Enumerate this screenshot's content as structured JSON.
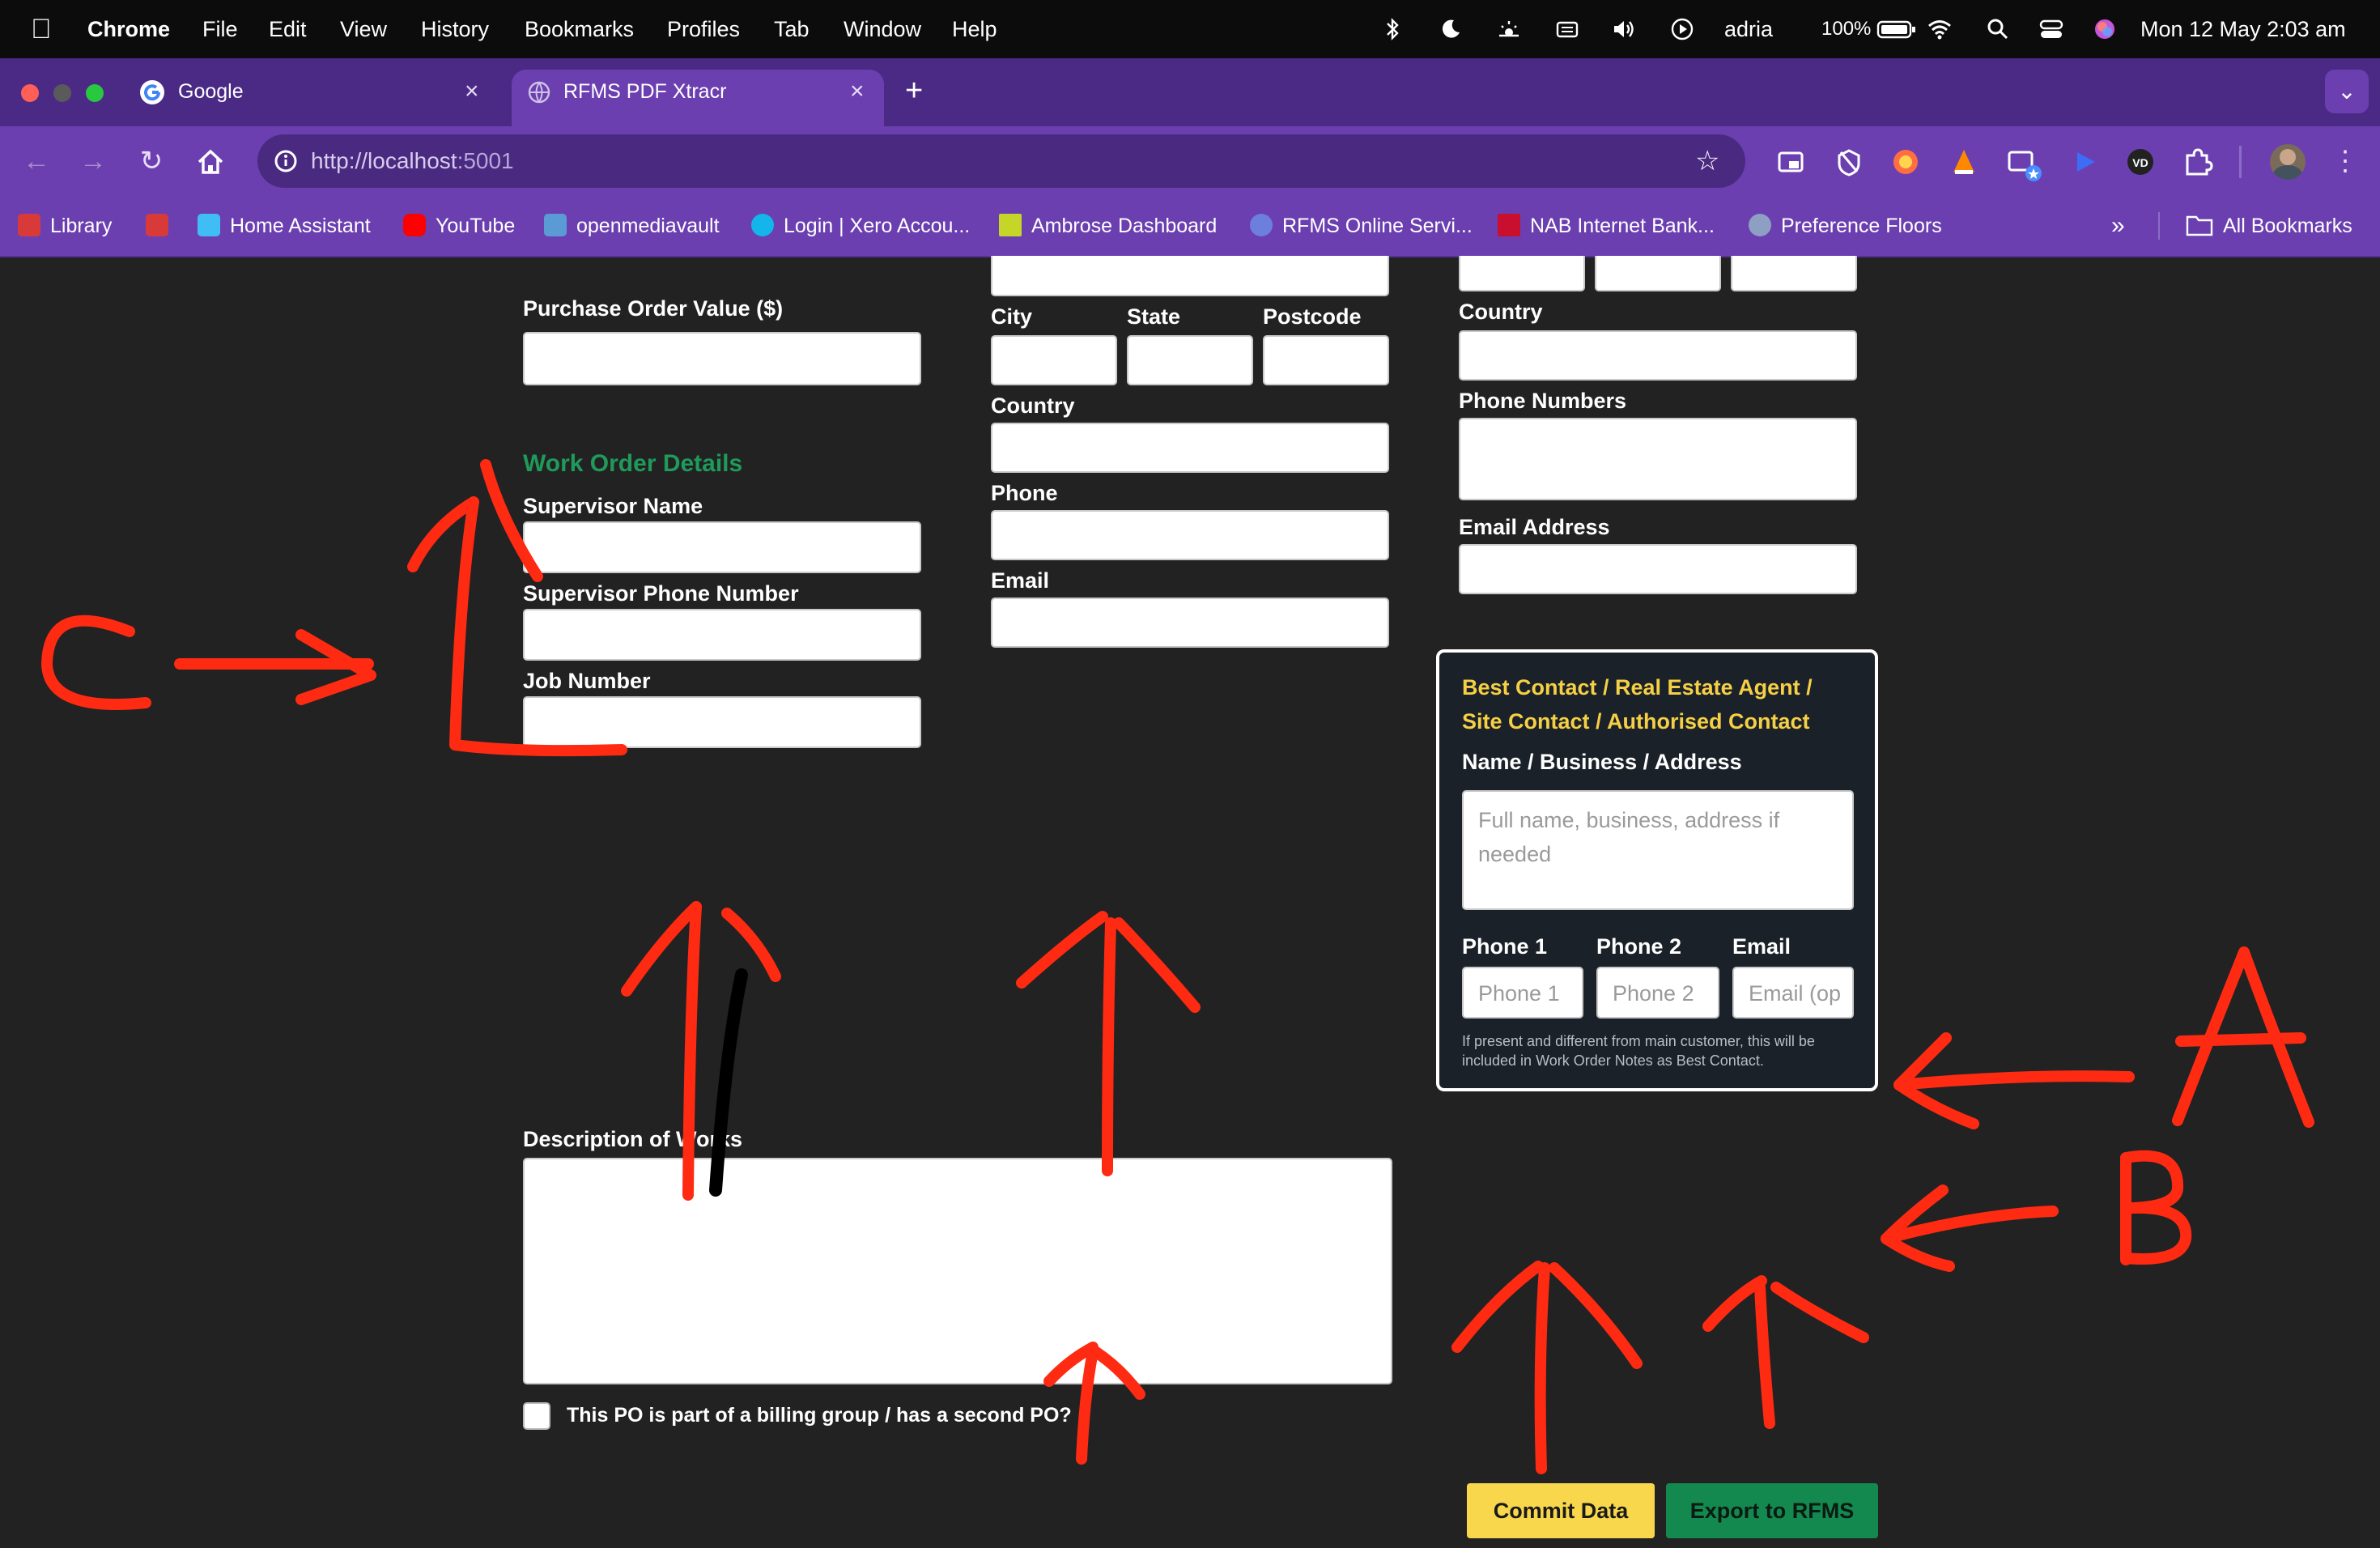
{
  "menubar": {
    "app": "Chrome",
    "items": [
      "File",
      "Edit",
      "View",
      "History",
      "Bookmarks",
      "Profiles",
      "Tab",
      "Window",
      "Help"
    ],
    "user": "adria",
    "battery": "100%",
    "datetime": "Mon 12 May  2:03 am"
  },
  "tabs": [
    {
      "title": "Google",
      "active": false,
      "icon": "google-icon"
    },
    {
      "title": "RFMS PDF Xtracr",
      "active": true,
      "icon": "globe-icon"
    }
  ],
  "toolbar": {
    "url_host": "http://localhost",
    "url_port": ":5001"
  },
  "bookmarks": [
    {
      "label": "Library",
      "icon": "library-icon",
      "color": "#d83a3a"
    },
    {
      "label": "",
      "icon": "library-icon-2",
      "color": "#d83a3a"
    },
    {
      "label": "Home Assistant",
      "icon": "home-assistant-icon",
      "color": "#41bdf5"
    },
    {
      "label": "YouTube",
      "icon": "youtube-icon",
      "color": "#ff0000"
    },
    {
      "label": "openmediavault",
      "icon": "omv-icon",
      "color": "#5b9bd5"
    },
    {
      "label": "Login | Xero Accou...",
      "icon": "xero-icon",
      "color": "#13b5ea"
    },
    {
      "label": "Ambrose Dashboard",
      "icon": "ta-icon",
      "color": "#c5d629"
    },
    {
      "label": "RFMS Online Servi...",
      "icon": "cloud-icon",
      "color": "#6d7fdc"
    },
    {
      "label": "NAB Internet Bank...",
      "icon": "nab-icon",
      "color": "#c8102e"
    },
    {
      "label": "Preference Floors",
      "icon": "pf-icon",
      "color": "#8da0c4"
    }
  ],
  "bookmarks_all": "All Bookmarks",
  "form": {
    "po_value_label": "Purchase Order Value ($)",
    "work_order_heading": "Work Order Details",
    "supervisor_name_label": "Supervisor Name",
    "supervisor_phone_label": "Supervisor Phone Number",
    "job_number_label": "Job Number",
    "city_label": "City",
    "state_label": "State",
    "postcode_label": "Postcode",
    "country_label": "Country",
    "phone_label": "Phone",
    "email_label": "Email",
    "country_label_right": "Country",
    "phone_numbers_label": "Phone Numbers",
    "email_address_label": "Email Address",
    "description_label": "Description of Works",
    "billing_group_label": "This PO is part of a billing group / has a second PO?"
  },
  "best_contact": {
    "heading_line1": "Best Contact / Real Estate Agent /",
    "heading_line2": "Site Contact / Authorised Contact",
    "name_label": "Name / Business / Address",
    "name_placeholder": "Full name, business, address if needed",
    "phone1_label": "Phone 1",
    "phone1_placeholder": "Phone 1",
    "phone2_label": "Phone 2",
    "phone2_placeholder": "Phone 2",
    "email_label": "Email",
    "email_placeholder": "Email (op",
    "note": "If present and different from main customer, this will be included in Work Order Notes as Best Contact."
  },
  "buttons": {
    "commit": "Commit Data",
    "export": "Export to RFMS"
  },
  "annotations": {
    "label_a": "A",
    "label_b": "B",
    "label_c": "C",
    "color": "#ff2a12"
  }
}
